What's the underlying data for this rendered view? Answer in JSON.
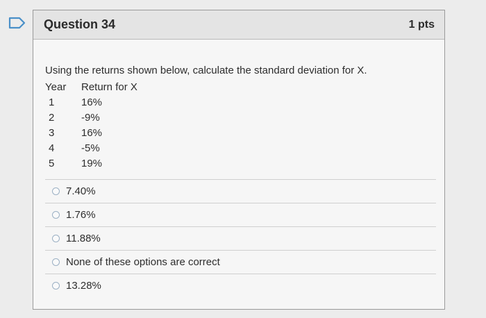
{
  "question": {
    "title": "Question 34",
    "points": "1 pts",
    "prompt": "Using the returns shown below, calculate the standard deviation for X.",
    "table": {
      "headers": [
        "Year",
        "Return for X"
      ],
      "rows": [
        [
          "1",
          "16%"
        ],
        [
          "2",
          "-9%"
        ],
        [
          "3",
          "16%"
        ],
        [
          "4",
          "-5%"
        ],
        [
          "5",
          "19%"
        ]
      ]
    },
    "answers": [
      "7.40%",
      "1.76%",
      "11.88%",
      "None of these options are correct",
      "13.28%"
    ]
  },
  "colors": {
    "flag": "#4a90c8",
    "card_header": "#e4e4e4",
    "radio_border": "#9bb0c4"
  }
}
